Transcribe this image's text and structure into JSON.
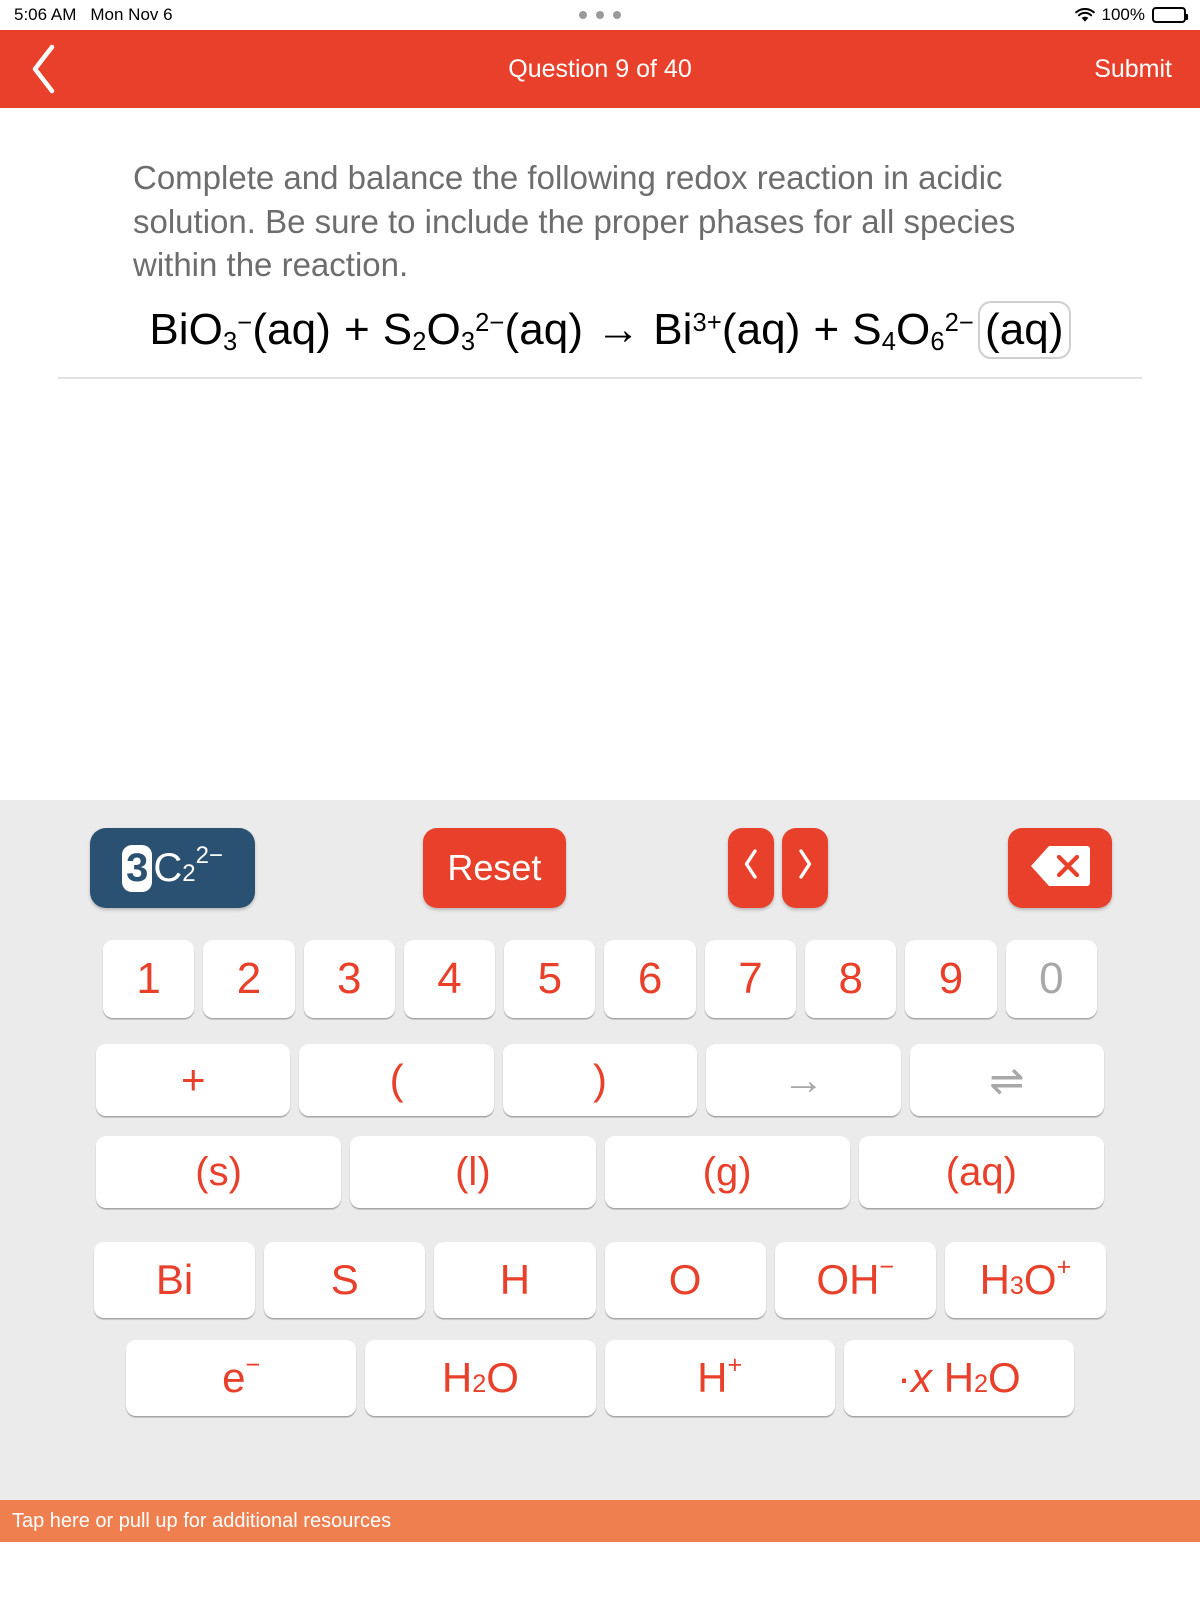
{
  "status_bar": {
    "time": "5:06 AM",
    "date": "Mon Nov 6",
    "battery_percent": "100%",
    "wifi_icon": "wifi-icon",
    "battery_icon": "battery-icon",
    "dots_icon": "more-dots-icon"
  },
  "nav": {
    "back_icon": "chevron-left-icon",
    "title": "Question 9 of 40",
    "submit_label": "Submit"
  },
  "question": {
    "prompt": "Complete and balance the following redox reaction in acidic solution. Be sure to include the proper phases for all species within the reaction.",
    "equation": {
      "plain": "BiO3-(aq) + S2O3 2-(aq) → Bi3+(aq) + S4O6 2-(aq)",
      "terms": [
        {
          "symbol": "BiO",
          "sub": "3",
          "sup": "−",
          "phase": "(aq)"
        },
        {
          "operator": "+"
        },
        {
          "symbol": "S",
          "sub": "2",
          "symbol2": "O",
          "sub2": "3",
          "sup": "2−",
          "phase": "(aq)"
        },
        {
          "operator": "→"
        },
        {
          "symbol": "Bi",
          "sup": "3+",
          "phase": "(aq)"
        },
        {
          "operator": "+"
        },
        {
          "symbol": "S",
          "sub": "4",
          "symbol2": "O",
          "sub2": "6",
          "sup": "2−",
          "phase": "(aq)",
          "selected": true
        }
      ],
      "parts": {
        "t1_sym": "BiO",
        "t1_sub": "3",
        "t1_sup": "−",
        "t1_phase": "(aq)",
        "op1": "+",
        "t2_sym": "S",
        "t2_sub": "2",
        "t2_sym2": "O",
        "t2_sub2": "3",
        "t2_sup": "2−",
        "t2_phase": "(aq)",
        "op2": "→",
        "t3_sym": "Bi",
        "t3_sup": "3+",
        "t3_phase": "(aq)",
        "op3": "+",
        "t4_sym": "S",
        "t4_sub": "4",
        "t4_sym2": "O",
        "t4_sub2": "6",
        "t4_sup": "2−",
        "t4_phase": "(aq)"
      }
    }
  },
  "keyboard": {
    "formula_chip": {
      "coefficient": "3",
      "symbol": "C",
      "subscript": "2",
      "superscript": "2−",
      "background_color": "#2b5172"
    },
    "reset_label": "Reset",
    "prev_label": "‹",
    "next_label": "›",
    "delete_icon": "backspace-icon",
    "numbers": [
      {
        "label": "1",
        "disabled": false
      },
      {
        "label": "2",
        "disabled": false
      },
      {
        "label": "3",
        "disabled": false
      },
      {
        "label": "4",
        "disabled": false
      },
      {
        "label": "5",
        "disabled": false
      },
      {
        "label": "6",
        "disabled": false
      },
      {
        "label": "7",
        "disabled": false
      },
      {
        "label": "8",
        "disabled": false
      },
      {
        "label": "9",
        "disabled": false
      },
      {
        "label": "0",
        "disabled": true
      }
    ],
    "operators": [
      {
        "label": "+",
        "disabled": false
      },
      {
        "label": "(",
        "disabled": false
      },
      {
        "label": ")",
        "disabled": false
      },
      {
        "label": "→",
        "disabled": true
      },
      {
        "label": "⇌",
        "disabled": true
      }
    ],
    "phases": [
      {
        "label": "(s)"
      },
      {
        "label": "(l)"
      },
      {
        "label": "(g)"
      },
      {
        "label": "(aq)"
      }
    ],
    "elements": [
      {
        "sym": "Bi"
      },
      {
        "sym": "S"
      },
      {
        "sym": "H"
      },
      {
        "sym": "O"
      },
      {
        "sym": "OH",
        "sup": "−"
      },
      {
        "sym": "H",
        "sub": "3",
        "sym2": "O",
        "sup": "+"
      }
    ],
    "species": [
      {
        "sym": "e",
        "sup": "−"
      },
      {
        "sym": "H",
        "sub": "2",
        "sym2": "O"
      },
      {
        "sym": "H",
        "sup": "+"
      },
      {
        "prefix": "·",
        "italic": "x",
        "sym": "H",
        "sub": "2",
        "sym2": "O"
      }
    ]
  },
  "drawer": {
    "label": "Tap here or pull up for additional resources",
    "background_color": "#ef7f4f"
  },
  "colors": {
    "accent_red": "#e8402a",
    "key_red": "#e8402a",
    "keyboard_bg": "#ebebeb",
    "chip_blue": "#2b5172",
    "question_text": "#6d6d6d"
  }
}
